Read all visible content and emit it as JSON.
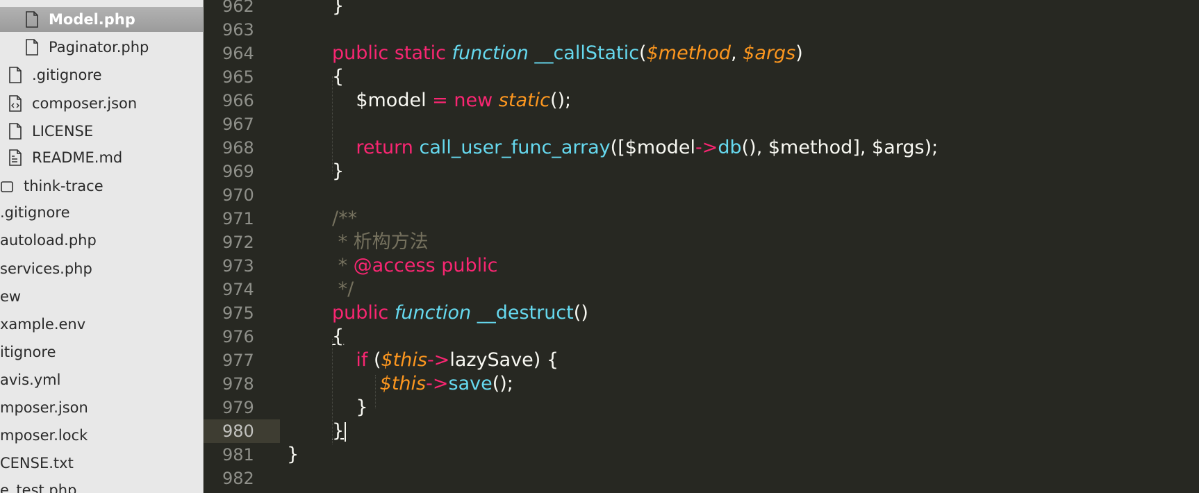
{
  "sidebar": {
    "items": [
      {
        "label": "Model.php",
        "icon": "file-icon",
        "selected": true
      },
      {
        "label": "Paginator.php",
        "icon": "file-icon"
      },
      {
        "label": ".gitignore",
        "icon": "file-icon"
      },
      {
        "label": "composer.json",
        "icon": "code-file-icon"
      },
      {
        "label": "LICENSE",
        "icon": "file-icon"
      },
      {
        "label": "README.md",
        "icon": "doc-file-icon"
      },
      {
        "label": "think-trace",
        "icon": "folder-icon"
      },
      {
        "label": ".gitignore"
      },
      {
        "label": "autoload.php"
      },
      {
        "label": "services.php"
      },
      {
        "label": "ew"
      },
      {
        "label": "xample.env"
      },
      {
        "label": "itignore"
      },
      {
        "label": "avis.yml"
      },
      {
        "label": "mposer.json"
      },
      {
        "label": "mposer.lock"
      },
      {
        "label": "CENSE.txt"
      },
      {
        "label": "e_test.php"
      }
    ]
  },
  "editor": {
    "current_line": "980",
    "lines": [
      {
        "num": "962",
        "tokens": [
          {
            "t": "}",
            "c": "plain"
          }
        ]
      },
      {
        "num": "963",
        "tokens": []
      },
      {
        "num": "964",
        "tokens": [
          {
            "t": "public ",
            "c": "kw"
          },
          {
            "t": "static ",
            "c": "st"
          },
          {
            "t": "function",
            "c": "fnk"
          },
          {
            "t": " ",
            "c": "plain"
          },
          {
            "t": "__callStatic",
            "c": "fn"
          },
          {
            "t": "(",
            "c": "plain"
          },
          {
            "t": "$method",
            "c": "var"
          },
          {
            "t": ", ",
            "c": "plain"
          },
          {
            "t": "$args",
            "c": "var"
          },
          {
            "t": ")",
            "c": "plain"
          }
        ]
      },
      {
        "num": "965",
        "tokens": [
          {
            "t": "{",
            "c": "plain"
          }
        ]
      },
      {
        "num": "966",
        "tokens": [
          {
            "t": "    $model ",
            "c": "plain"
          },
          {
            "t": "=",
            "c": "kw"
          },
          {
            "t": " ",
            "c": "plain"
          },
          {
            "t": "new",
            "c": "kw"
          },
          {
            "t": " ",
            "c": "plain"
          },
          {
            "t": "static",
            "c": "var"
          },
          {
            "t": "();",
            "c": "plain"
          }
        ]
      },
      {
        "num": "967",
        "tokens": []
      },
      {
        "num": "968",
        "tokens": [
          {
            "t": "    ",
            "c": "plain"
          },
          {
            "t": "return",
            "c": "kw"
          },
          {
            "t": " ",
            "c": "plain"
          },
          {
            "t": "call_user_func_array",
            "c": "fn"
          },
          {
            "t": "([$model",
            "c": "plain"
          },
          {
            "t": "->",
            "c": "kw"
          },
          {
            "t": "db",
            "c": "fn"
          },
          {
            "t": "(), $method], $args);",
            "c": "plain"
          }
        ]
      },
      {
        "num": "969",
        "tokens": [
          {
            "t": "}",
            "c": "plain"
          }
        ]
      },
      {
        "num": "970",
        "tokens": []
      },
      {
        "num": "971",
        "tokens": [
          {
            "t": "/**",
            "c": "cm"
          }
        ]
      },
      {
        "num": "972",
        "tokens": [
          {
            "t": " * 析构方法",
            "c": "cm"
          }
        ]
      },
      {
        "num": "973",
        "tokens": [
          {
            "t": " * ",
            "c": "cm"
          },
          {
            "t": "@access",
            "c": "tag"
          },
          {
            "t": " ",
            "c": "cm"
          },
          {
            "t": "public",
            "c": "kw"
          }
        ]
      },
      {
        "num": "974",
        "tokens": [
          {
            "t": " */",
            "c": "cm"
          }
        ]
      },
      {
        "num": "975",
        "tokens": [
          {
            "t": "public ",
            "c": "kw"
          },
          {
            "t": "function",
            "c": "fnk"
          },
          {
            "t": " ",
            "c": "plain"
          },
          {
            "t": "__destruct",
            "c": "fn"
          },
          {
            "t": "()",
            "c": "plain"
          }
        ]
      },
      {
        "num": "976",
        "tokens": [
          {
            "t": "{",
            "c": "plain ul"
          }
        ]
      },
      {
        "num": "977",
        "tokens": [
          {
            "t": "    ",
            "c": "plain"
          },
          {
            "t": "if",
            "c": "kw"
          },
          {
            "t": " (",
            "c": "plain"
          },
          {
            "t": "$this",
            "c": "var"
          },
          {
            "t": "->",
            "c": "kw"
          },
          {
            "t": "lazySave) {",
            "c": "plain"
          }
        ]
      },
      {
        "num": "978",
        "tokens": [
          {
            "t": "        ",
            "c": "plain"
          },
          {
            "t": "$this",
            "c": "var"
          },
          {
            "t": "->",
            "c": "kw"
          },
          {
            "t": "save",
            "c": "fn"
          },
          {
            "t": "();",
            "c": "plain"
          }
        ]
      },
      {
        "num": "979",
        "tokens": [
          {
            "t": "    }",
            "c": "plain"
          }
        ]
      },
      {
        "num": "980",
        "tokens": [
          {
            "t": "}",
            "c": "plain ul"
          },
          {
            "t": "",
            "c": "caret"
          }
        ]
      },
      {
        "num": "981",
        "tokens": [
          {
            "t": "}",
            "c": "plain"
          }
        ]
      },
      {
        "num": "982",
        "tokens": []
      }
    ]
  }
}
